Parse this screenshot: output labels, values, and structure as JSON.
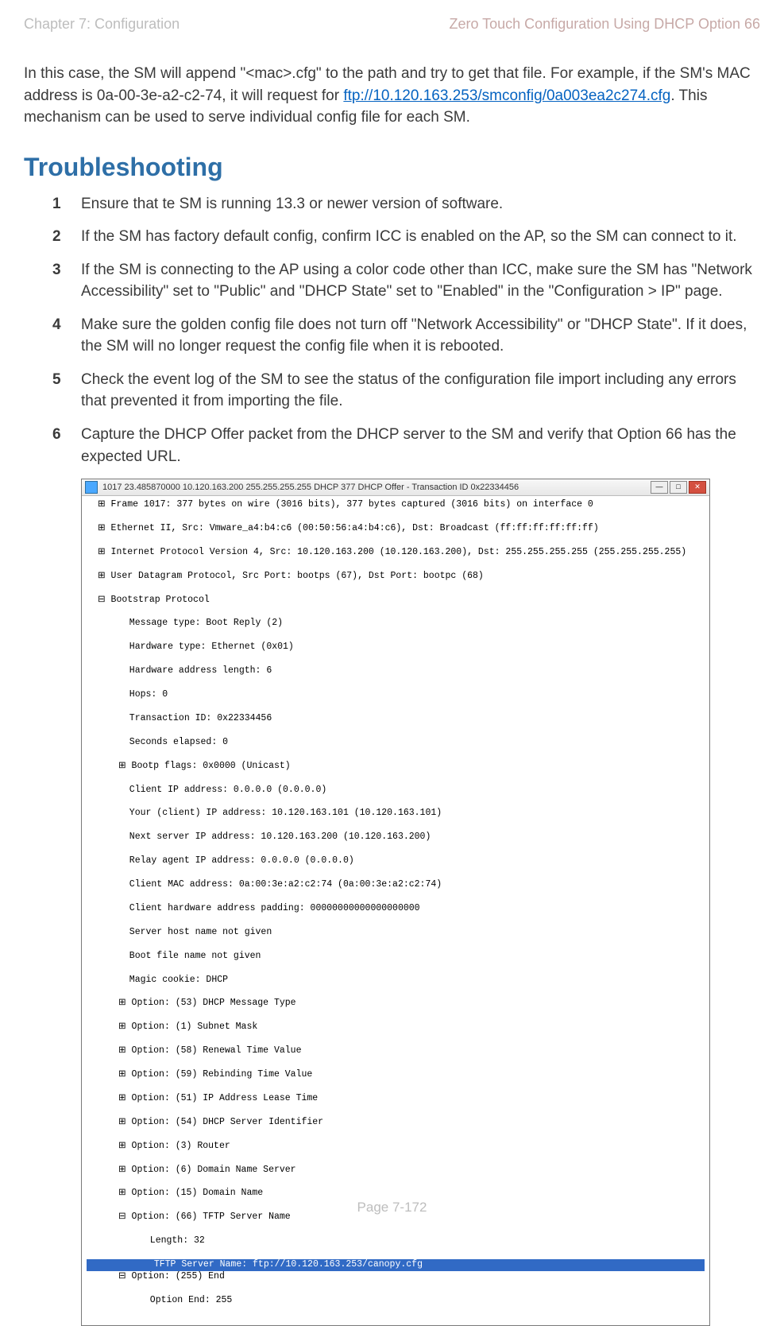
{
  "header": {
    "left": "Chapter 7:  Configuration",
    "right": "Zero Touch Configuration Using DHCP Option 66"
  },
  "intro": {
    "part1": "In this case, the SM will append \"<mac>.cfg\" to the path and try to get that file. For example, if the SM's MAC address is 0a-00-3e-a2-c2-74, it will request for ",
    "url": "ftp://10.120.163.253/smconfig/0a003ea2c274.cfg",
    "part2": ". This mechanism can be used to serve individual config file for each SM."
  },
  "section_title": "Troubleshooting",
  "steps": [
    "Ensure that te SM is running 13.3 or newer version of software.",
    "If the SM has factory default config, confirm ICC is enabled on the AP, so the SM can connect to it.",
    "If the SM is connecting to the AP using a color code other than ICC, make sure the SM has \"Network Accessibility\" set to \"Public\" and \"DHCP State\" set to \"Enabled\" in the \"Configuration > IP\" page.",
    "Make sure the golden config file does not turn off \"Network Accessibility\" or \"DHCP State\". If it does, the SM will no longer request the config file when it is rebooted.",
    "Check the event log of the SM to see the status of the configuration file import including any errors that prevented it from importing the file.",
    "Capture the DHCP Offer packet from the DHCP server to the SM and verify that Option 66 has the expected URL."
  ],
  "capture": {
    "title": "1017 23.485870000 10.120.163.200 255.255.255.255 DHCP 377 DHCP Offer  - Transaction ID 0x22334456",
    "lines_top": [
      {
        "t": "⊞",
        "i": 1,
        "s": "Frame 1017: 377 bytes on wire (3016 bits), 377 bytes captured (3016 bits) on interface 0"
      },
      {
        "t": "⊞",
        "i": 1,
        "s": "Ethernet II, Src: Vmware_a4:b4:c6 (00:50:56:a4:b4:c6), Dst: Broadcast (ff:ff:ff:ff:ff:ff)"
      },
      {
        "t": "⊞",
        "i": 1,
        "s": "Internet Protocol Version 4, Src: 10.120.163.200 (10.120.163.200), Dst: 255.255.255.255 (255.255.255.255)"
      },
      {
        "t": "⊞",
        "i": 1,
        "s": "User Datagram Protocol, Src Port: bootps (67), Dst Port: bootpc (68)"
      },
      {
        "t": "⊟",
        "i": 1,
        "s": "Bootstrap Protocol"
      },
      {
        "t": "",
        "i": 2,
        "s": "Message type: Boot Reply (2)"
      },
      {
        "t": "",
        "i": 2,
        "s": "Hardware type: Ethernet (0x01)"
      },
      {
        "t": "",
        "i": 2,
        "s": "Hardware address length: 6"
      },
      {
        "t": "",
        "i": 2,
        "s": "Hops: 0"
      },
      {
        "t": "",
        "i": 2,
        "s": "Transaction ID: 0x22334456"
      },
      {
        "t": "",
        "i": 2,
        "s": "Seconds elapsed: 0"
      },
      {
        "t": "⊞",
        "i": 2,
        "s": "Bootp flags: 0x0000 (Unicast)"
      },
      {
        "t": "",
        "i": 2,
        "s": "Client IP address: 0.0.0.0 (0.0.0.0)"
      },
      {
        "t": "",
        "i": 2,
        "s": "Your (client) IP address: 10.120.163.101 (10.120.163.101)"
      },
      {
        "t": "",
        "i": 2,
        "s": "Next server IP address: 10.120.163.200 (10.120.163.200)"
      },
      {
        "t": "",
        "i": 2,
        "s": "Relay agent IP address: 0.0.0.0 (0.0.0.0)"
      },
      {
        "t": "",
        "i": 2,
        "s": "Client MAC address: 0a:00:3e:a2:c2:74 (0a:00:3e:a2:c2:74)"
      },
      {
        "t": "",
        "i": 2,
        "s": "Client hardware address padding: 00000000000000000000"
      },
      {
        "t": "",
        "i": 2,
        "s": "Server host name not given"
      },
      {
        "t": "",
        "i": 2,
        "s": "Boot file name not given"
      },
      {
        "t": "",
        "i": 2,
        "s": "Magic cookie: DHCP"
      },
      {
        "t": "⊞",
        "i": 2,
        "s": "Option: (53) DHCP Message Type"
      },
      {
        "t": "⊞",
        "i": 2,
        "s": "Option: (1) Subnet Mask"
      },
      {
        "t": "⊞",
        "i": 2,
        "s": "Option: (58) Renewal Time Value"
      },
      {
        "t": "⊞",
        "i": 2,
        "s": "Option: (59) Rebinding Time Value"
      },
      {
        "t": "⊞",
        "i": 2,
        "s": "Option: (51) IP Address Lease Time"
      },
      {
        "t": "⊞",
        "i": 2,
        "s": "Option: (54) DHCP Server Identifier"
      },
      {
        "t": "⊞",
        "i": 2,
        "s": "Option: (3) Router"
      },
      {
        "t": "⊞",
        "i": 2,
        "s": "Option: (6) Domain Name Server"
      },
      {
        "t": "⊞",
        "i": 2,
        "s": "Option: (15) Domain Name"
      },
      {
        "t": "⊟",
        "i": 2,
        "s": "Option: (66) TFTP Server Name"
      },
      {
        "t": "",
        "i": 3,
        "s": "Length: 32"
      }
    ],
    "highlight": "TFTP Server Name: ftp://10.120.163.253/canopy.cfg",
    "lines_bottom": [
      {
        "t": "⊟",
        "i": 2,
        "s": "Option: (255) End"
      },
      {
        "t": "",
        "i": 3,
        "s": "Option End: 255"
      }
    ]
  },
  "footer": "Page 7-172"
}
